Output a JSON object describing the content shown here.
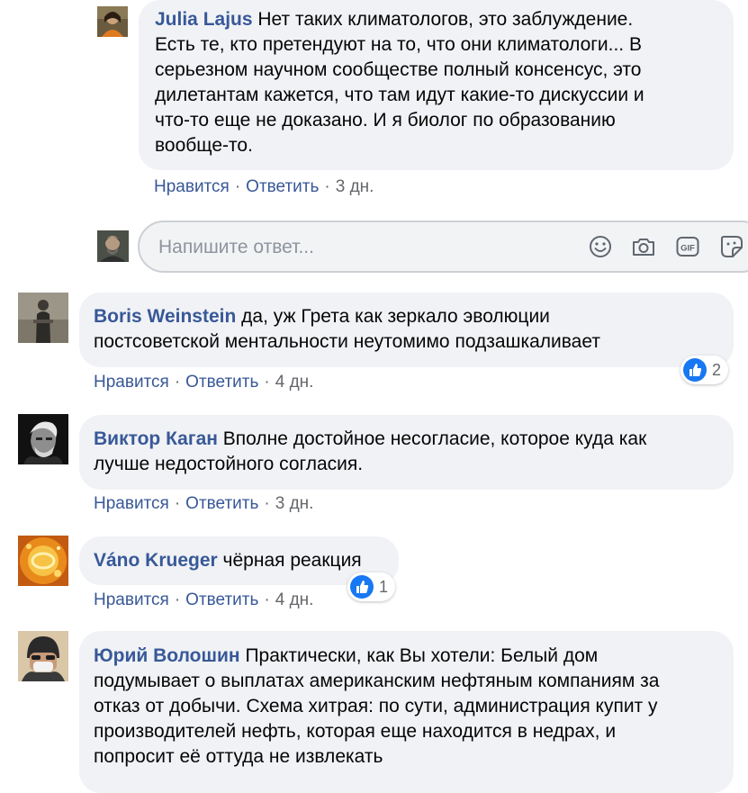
{
  "comments": [
    {
      "author": "Julia Lajus",
      "text_lines": [
        "Нет таких климатологов, это заблуждение.",
        "Есть те, кто претендуют на то, что они климатологи... В",
        "серьезном научном сообществе полный консенсус, это",
        "дилетантам кажется, что там идут какие-то дискуссии и",
        "что-то еще не доказано. И я биолог по образованию",
        "вообще-то."
      ],
      "like": "Нравится",
      "reply": "Ответить",
      "time": "3 дн."
    },
    {
      "author": "Boris Weinstein",
      "text_lines": [
        "да, уж Грета как зеркало эволюции",
        "постсоветской ментальности неутомимо подзашкаливает"
      ],
      "like": "Нравится",
      "reply": "Ответить",
      "time": "4 дн.",
      "reaction_count": "2"
    },
    {
      "author": "Виктор Каган",
      "text_lines": [
        "Вполне достойное несогласие, которое куда как",
        "лучше недостойного согласия."
      ],
      "like": "Нравится",
      "reply": "Ответить",
      "time": "3 дн."
    },
    {
      "author": "Váno Krueger",
      "text_lines": [
        "чёрная реакция"
      ],
      "like": "Нравится",
      "reply": "Ответить",
      "time": "4 дн.",
      "reaction_count": "1"
    },
    {
      "author": "Юрий Волошин",
      "text_lines": [
        "Практически, как Вы хотели: Белый дом",
        "подумывает о выплатах американским нефтяным компаниям за",
        "отказ от добычи. Схема хитрая: по сути, администрация купит у",
        "производителей нефть, которая еще находится в недрах, и",
        "попросит её оттуда не извлекать"
      ]
    }
  ],
  "reply_box": {
    "placeholder": "Напишите ответ...",
    "tools": [
      "emoji-icon",
      "camera-icon",
      "gif-icon",
      "sticker-icon"
    ]
  },
  "dot_separator": "·",
  "colors": {
    "author": "#385898",
    "bubble": "#f0f2f5",
    "meta": "#65676b",
    "like_blue": "#1877f2"
  }
}
